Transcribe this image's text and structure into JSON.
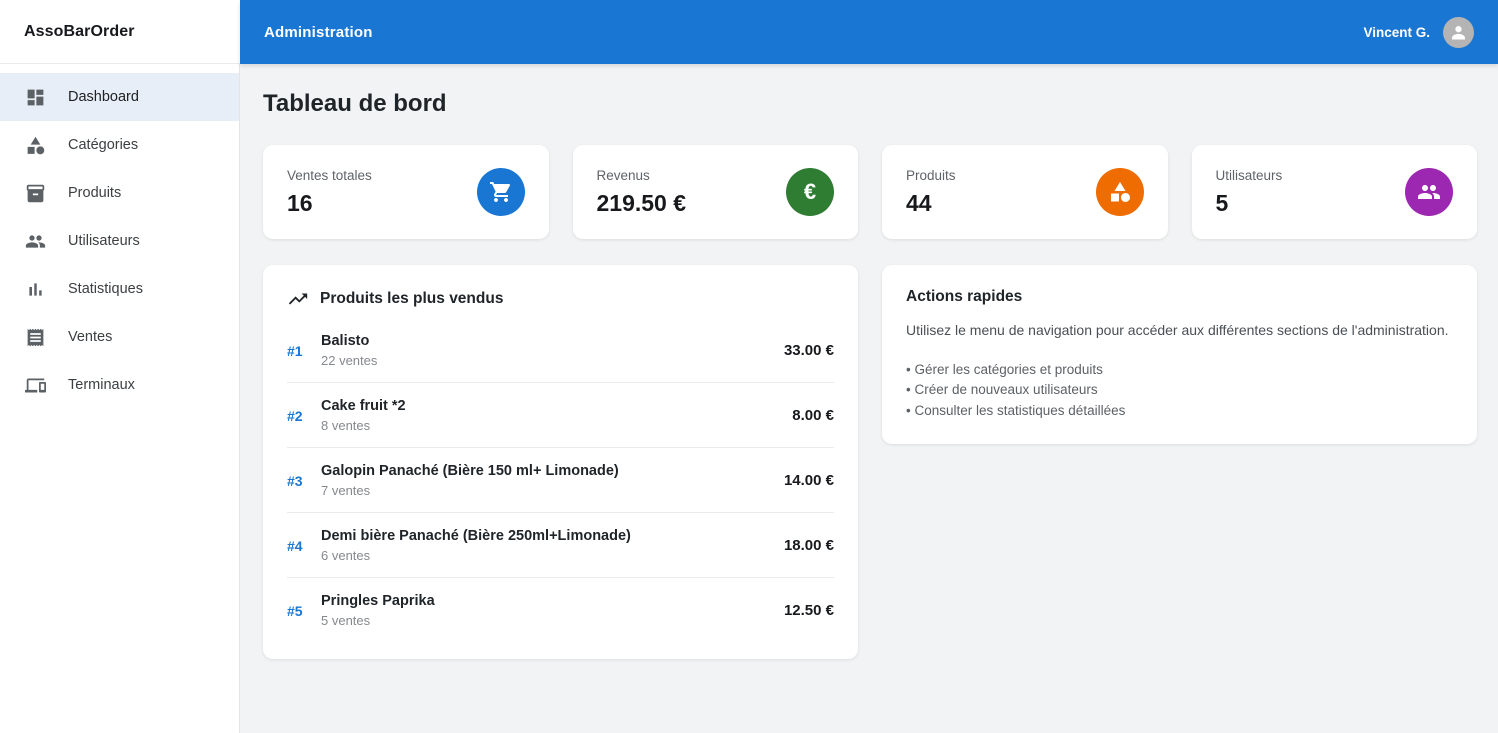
{
  "brand": "AssoBarOrder",
  "header": {
    "title": "Administration",
    "user_name": "Vincent G."
  },
  "colors": {
    "appbar_blue": "#1976d2",
    "active_nav_bg": "#e8eef7",
    "rank_accent": "#1976d2"
  },
  "sidebar": {
    "items": [
      {
        "label": "Dashboard",
        "icon": "dashboard-icon",
        "active": true
      },
      {
        "label": "Catégories",
        "icon": "category-icon",
        "active": false
      },
      {
        "label": "Produits",
        "icon": "inventory-icon",
        "active": false
      },
      {
        "label": "Utilisateurs",
        "icon": "people-icon",
        "active": false
      },
      {
        "label": "Statistiques",
        "icon": "bar-chart-icon",
        "active": false
      },
      {
        "label": "Ventes",
        "icon": "receipt-icon",
        "active": false
      },
      {
        "label": "Terminaux",
        "icon": "devices-icon",
        "active": false
      }
    ]
  },
  "page": {
    "title": "Tableau de bord"
  },
  "stats": [
    {
      "label": "Ventes totales",
      "value": "16",
      "icon": "cart-icon",
      "color": "#1976d2"
    },
    {
      "label": "Revenus",
      "value": "219.50 €",
      "icon": "euro-icon",
      "color": "#2e7d32",
      "icon_glyph": "€"
    },
    {
      "label": "Produits",
      "value": "44",
      "icon": "category-icon",
      "color": "#ef6c00"
    },
    {
      "label": "Utilisateurs",
      "value": "5",
      "icon": "people-icon",
      "color": "#9c27b0"
    }
  ],
  "top_products": {
    "title": "Produits les plus vendus",
    "items": [
      {
        "rank": "#1",
        "name": "Balisto",
        "sales": "22 ventes",
        "price": "33.00 €"
      },
      {
        "rank": "#2",
        "name": "Cake fruit *2",
        "sales": "8 ventes",
        "price": "8.00 €"
      },
      {
        "rank": "#3",
        "name": "Galopin Panaché (Bière 150 ml+ Limonade)",
        "sales": "7 ventes",
        "price": "14.00 €"
      },
      {
        "rank": "#4",
        "name": "Demi bière Panaché (Bière 250ml+Limonade)",
        "sales": "6 ventes",
        "price": "18.00 €"
      },
      {
        "rank": "#5",
        "name": "Pringles Paprika",
        "sales": "5 ventes",
        "price": "12.50 €"
      }
    ]
  },
  "quick_actions": {
    "title": "Actions rapides",
    "description": "Utilisez le menu de navigation pour accéder aux différentes sections de l'administration.",
    "bullets": [
      "Gérer les catégories et produits",
      "Créer de nouveaux utilisateurs",
      "Consulter les statistiques détaillées"
    ]
  }
}
